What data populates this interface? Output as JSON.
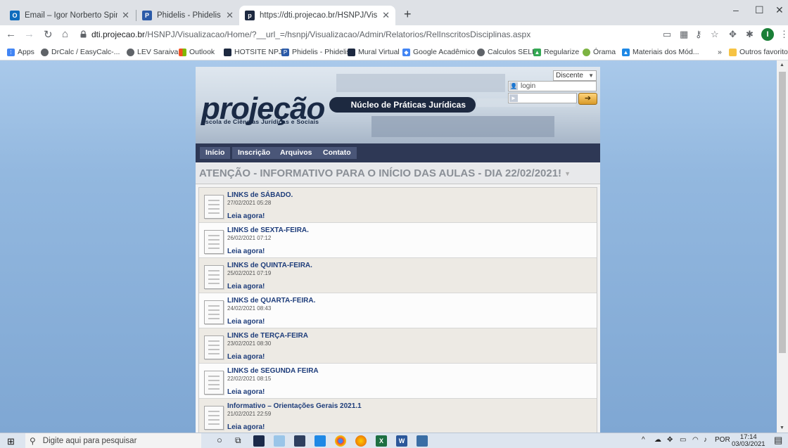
{
  "browser": {
    "tabs": [
      {
        "title": "Email – Igor Norberto Spindola C",
        "icon": "outlook-icon",
        "color": "#0f6cbd"
      },
      {
        "title": "Phidelis - Phidelis",
        "icon": "phidelis-icon",
        "color": "#2b5aa8"
      },
      {
        "title": "https://dti.projecao.br/HSNPJ/Vis",
        "icon": "projecao-icon",
        "color": "#1d2940"
      }
    ],
    "new_tab": "+",
    "window_controls": [
      "–",
      "☐",
      "✕"
    ],
    "url_host": "dti.projecao.br",
    "url_path": "/HSNPJ/Visualizacao/Home/?__url_=/hsnpj/Visualizacao/Admin/Relatorios/RelInscritosDisciplinas.aspx",
    "profile_initial": "I",
    "bookmarks": [
      {
        "label": "Apps",
        "icon": "apps-grid-icon",
        "color": "#4285f4"
      },
      {
        "label": "DrCalc / EasyCalc-...",
        "icon": "globe-icon",
        "color": "#5f6368"
      },
      {
        "label": "LEV Saraiva",
        "icon": "globe-icon",
        "color": "#5f6368"
      },
      {
        "label": "Outlook",
        "icon": "outlook-icon",
        "color": "#f25022"
      },
      {
        "label": "HOTSITE NPJ",
        "icon": "projecao-icon",
        "color": "#1d2940"
      },
      {
        "label": "Phidelis - Phidelis",
        "icon": "phidelis-icon",
        "color": "#2b5aa8"
      },
      {
        "label": "Mural Virtual",
        "icon": "projecao-icon",
        "color": "#1d2940"
      },
      {
        "label": "Google Acadêmico",
        "icon": "scholar-icon",
        "color": "#4285f4"
      },
      {
        "label": "Calculos SELIC",
        "icon": "globe-icon",
        "color": "#5f6368"
      },
      {
        "label": "Regularize",
        "icon": "drive-icon",
        "color": "#34a853"
      },
      {
        "label": "Órama",
        "icon": "orama-icon",
        "color": "#7cb342"
      },
      {
        "label": "Materiais dos Mód...",
        "icon": "drive-icon",
        "color": "#1e88e5"
      }
    ],
    "bookmarks_overflow": "»",
    "other_bookmarks": "Outros favoritos"
  },
  "site": {
    "logo": "projeção",
    "logo_subtitle": "Escola de Ciências Jurídicas e Sociais",
    "banner_title": "Núcleo de Práticas Jurídicas",
    "profile_select": "Discente",
    "login_placeholder": "login",
    "menu": [
      "Início",
      "Inscrição",
      "Arquivos",
      "Contato"
    ],
    "heading": "ATENÇÃO - INFORMATIVO PARA O INÍCIO DAS AULAS - DIA 22/02/2021!",
    "news": [
      {
        "title": "LINKS de SÁBADO.",
        "date": "27/02/2021 05:28",
        "link": "Leia agora!"
      },
      {
        "title": "LINKS de SEXTA-FEIRA.",
        "date": "26/02/2021 07:12",
        "link": "Leia agora!"
      },
      {
        "title": "LINKS de QUINTA-FEIRA.",
        "date": "25/02/2021 07:19",
        "link": "Leia agora!"
      },
      {
        "title": "LINKS de QUARTA-FEIRA.",
        "date": "24/02/2021 08:43",
        "link": "Leia agora!"
      },
      {
        "title": "LINKS de TERÇA-FEIRA",
        "date": "23/02/2021 08:30",
        "link": "Leia agora!"
      },
      {
        "title": "LINKS de SEGUNDA FEIRA",
        "date": "22/02/2021 08:15",
        "link": "Leia agora!"
      },
      {
        "title": "Informativo – Orientações Gerais 2021.1",
        "date": "21/02/2021 22:59",
        "link": "Leia agora!"
      }
    ]
  },
  "taskbar": {
    "search_placeholder": "Digite aqui para pesquisar",
    "language": "POR",
    "time": "17:14",
    "date": "03/03/2021"
  }
}
